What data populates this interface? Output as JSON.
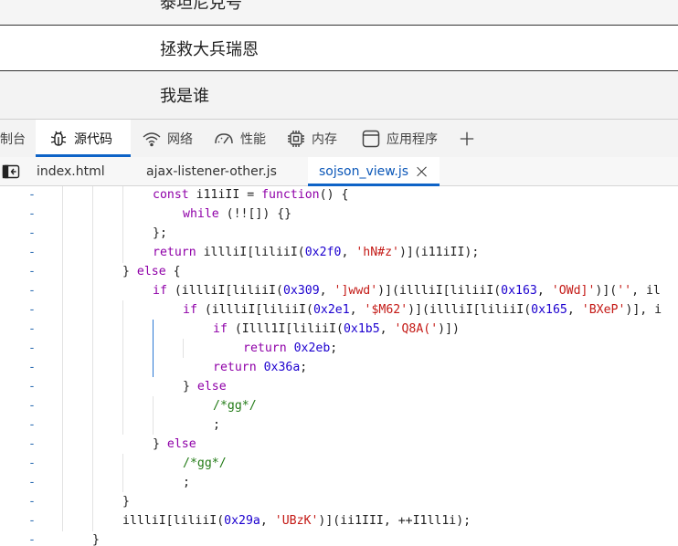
{
  "page_list": {
    "rows": [
      "泰坦尼克号",
      "拯救大兵瑞恩",
      "我是谁"
    ]
  },
  "devtools": {
    "tool_tabs": [
      {
        "label": "制台",
        "icon": "console-icon"
      },
      {
        "label": "源代码",
        "icon": "bug-icon",
        "active": true
      },
      {
        "label": "网络",
        "icon": "wifi-icon"
      },
      {
        "label": "性能",
        "icon": "performance-gauge-icon"
      },
      {
        "label": "内存",
        "icon": "memory-chip-icon"
      },
      {
        "label": "应用程序",
        "icon": "application-window-icon"
      },
      {
        "label": "+",
        "icon": "add-tool-icon"
      }
    ],
    "file_tabs": [
      {
        "label": "index.html"
      },
      {
        "label": "ajax-listener-other.js"
      },
      {
        "label": "sojson_view.js",
        "active": true
      }
    ],
    "accent_color": "#0e63c7"
  },
  "code": {
    "gutter_marker": "-",
    "lines": [
      {
        "indent": 4,
        "html": "<span class=\"k\">const</span> i11iII = <span class=\"k\">function</span>() {"
      },
      {
        "indent": 5,
        "html": "<span class=\"k\">while</span> (!![]) {}"
      },
      {
        "indent": 4,
        "html": "};"
      },
      {
        "indent": 4,
        "html": "<span class=\"k\">return</span> illliI[liliiI(<span class=\"n\">0x2f0</span>, <span class=\"s\">'hN#z'</span>)](i11iII);"
      },
      {
        "indent": 3,
        "html": "} <span class=\"k\">else</span> {"
      },
      {
        "indent": 4,
        "html": "<span class=\"k\">if</span> (illliI[liliiI(<span class=\"n\">0x309</span>, <span class=\"s\">']wwd'</span>)](illliI[liliiI(<span class=\"n\">0x163</span>, <span class=\"s\">'OWd]'</span>)](<span class=\"s\">''</span>, il"
      },
      {
        "indent": 5,
        "html": "<span class=\"k\">if</span> (illliI[liliiI(<span class=\"n\">0x2e1</span>, <span class=\"s\">'$M62'</span>)](illliI[liliiI(<span class=\"n\">0x165</span>, <span class=\"s\">'BXeP'</span>)], i"
      },
      {
        "indent": 6,
        "html": "<span class=\"k\">if</span> (Illl1I[liliiI(<span class=\"n\">0x1b5</span>, <span class=\"s\">'Q8A('</span>)])"
      },
      {
        "indent": 7,
        "html": "<span class=\"k\">return</span> <span class=\"n\">0x2eb</span>;"
      },
      {
        "indent": 6,
        "html": "<span class=\"k\">return</span> <span class=\"n\">0x36a</span>;"
      },
      {
        "indent": 5,
        "html": "} <span class=\"k\">else</span>"
      },
      {
        "indent": 6,
        "html": "<span class=\"c\">/*gg*/</span>"
      },
      {
        "indent": 6,
        "html": ";"
      },
      {
        "indent": 4,
        "html": "} <span class=\"k\">else</span>"
      },
      {
        "indent": 5,
        "html": "<span class=\"c\">/*gg*/</span>"
      },
      {
        "indent": 5,
        "html": ";"
      },
      {
        "indent": 3,
        "html": "}"
      },
      {
        "indent": 3,
        "html": "illliI[liliiI(<span class=\"n\">0x29a</span>, <span class=\"s\">'UBzK'</span>)](ii1III, ++I1ll1i);"
      },
      {
        "indent": 2,
        "html": "}"
      }
    ]
  }
}
